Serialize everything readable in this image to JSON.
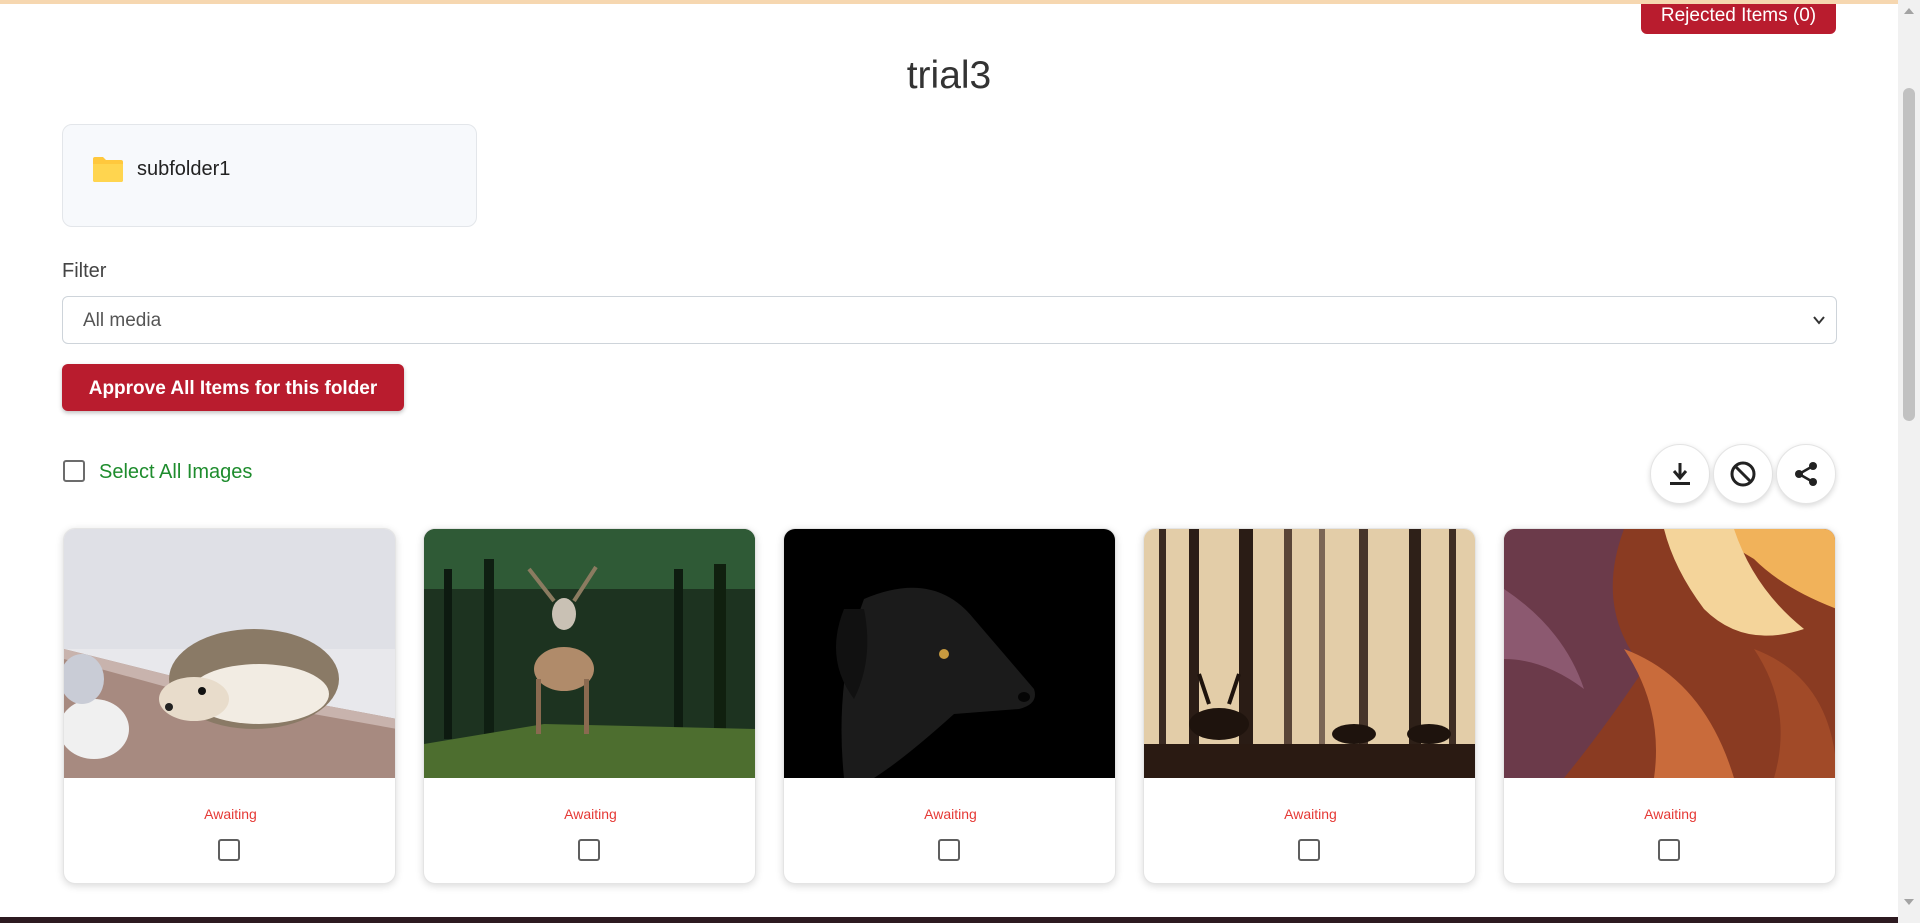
{
  "header": {
    "rejected_button_label": "Rejected Items (0)",
    "page_title": "trial3"
  },
  "folders": [
    {
      "name": "subfolder1",
      "icon": "folder-icon",
      "color": "#ffc83d"
    }
  ],
  "filter": {
    "label": "Filter",
    "selected": "All media"
  },
  "approve_button_label": "Approve All Items for this folder",
  "select_all_label": "Select All Images",
  "actions": [
    {
      "name": "download-button",
      "icon": "download-icon"
    },
    {
      "name": "reject-button",
      "icon": "block-icon"
    },
    {
      "name": "share-button",
      "icon": "share-icon"
    }
  ],
  "items": [
    {
      "image": "hedgehog",
      "status": "Awaiting",
      "checked": false
    },
    {
      "image": "deer-in-forest",
      "status": "Awaiting",
      "checked": false
    },
    {
      "image": "black-dog",
      "status": "Awaiting",
      "checked": false
    },
    {
      "image": "misty-forest-deer",
      "status": "Awaiting",
      "checked": false
    },
    {
      "image": "canyon",
      "status": "Awaiting",
      "checked": false
    }
  ],
  "colors": {
    "accent": "#b91c2e",
    "select_all_text": "#1e8c2d",
    "status_text": "#e53935"
  }
}
